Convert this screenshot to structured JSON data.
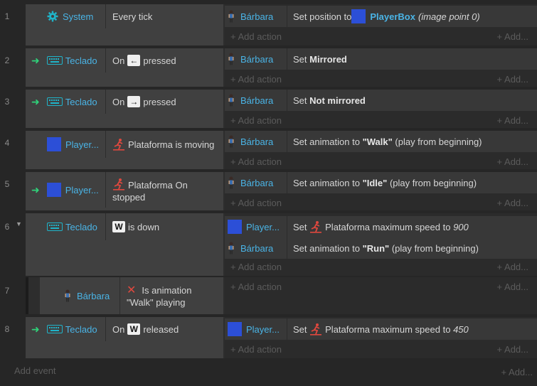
{
  "add_action": "+ Add action",
  "add_more": "+ Add...",
  "add_event": "Add event",
  "colors": {
    "object": "#4ab4e6",
    "trigger_arrow": "#2fd27a",
    "blue_box": "#2c4fd7",
    "negate": "#e0483e"
  },
  "events": [
    {
      "num": "1",
      "cond_obj": "System",
      "cond_text": "Every tick",
      "act_obj": "Bárbara",
      "act_prefix": "Set position to ",
      "act_obj2": "PlayerBox",
      "act_suffix": "(image point 0)"
    },
    {
      "num": "2",
      "cond_obj": "Teclado",
      "cond_pre": "On",
      "cond_key": "←",
      "cond_post": "pressed",
      "act_obj": "Bárbara",
      "act_pre": "Set",
      "act_bold": "Mirrored"
    },
    {
      "num": "3",
      "cond_obj": "Teclado",
      "cond_pre": "On",
      "cond_key": "→",
      "cond_post": "pressed",
      "act_obj": "Bárbara",
      "act_pre": "Set",
      "act_bold": "Not mirrored"
    },
    {
      "num": "4",
      "cond_obj": "Player...",
      "cond_text": "Plataforma is moving",
      "act_obj": "Bárbara",
      "act_pre": "Set animation to",
      "act_bold": "\"Walk\"",
      "act_post": "(play from beginning)"
    },
    {
      "num": "5",
      "cond_obj": "Player...",
      "cond_text": "Plataforma On stopped",
      "act_obj": "Bárbara",
      "act_pre": "Set animation to",
      "act_bold": "\"Idle\"",
      "act_post": "(play from beginning)"
    },
    {
      "num": "6",
      "cond_obj": "Teclado",
      "cond_key": "W",
      "cond_post": "is down",
      "actions": [
        {
          "obj": "Player...",
          "pre": "Set",
          "text": "Plataforma maximum speed to",
          "val": "900"
        },
        {
          "obj": "Bárbara",
          "pre": "Set animation to",
          "bold": "\"Run\"",
          "post": "(play from beginning)"
        }
      ]
    },
    {
      "num": "7",
      "cond_obj": "Bárbara",
      "cond_text": "Is animation \"Walk\" playing"
    },
    {
      "num": "8",
      "cond_obj": "Teclado",
      "cond_pre": "On",
      "cond_key": "W",
      "cond_post": "released",
      "act_obj": "Player...",
      "act_pre": "Set",
      "act_text": "Plataforma maximum speed to",
      "act_val": "450"
    }
  ]
}
